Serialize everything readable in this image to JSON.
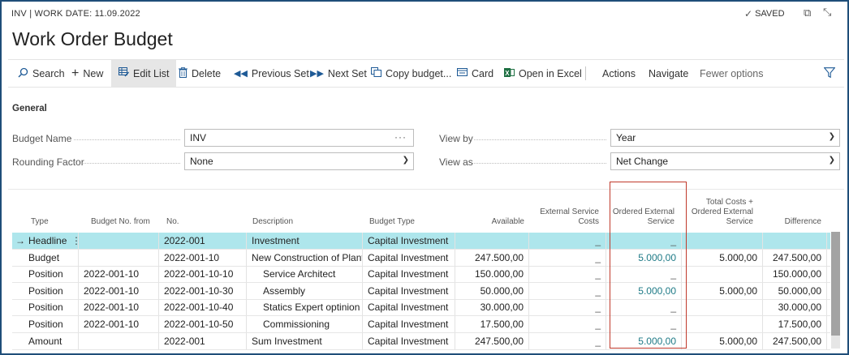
{
  "header": {
    "topline": "INV | WORK DATE: 11.09.2022",
    "saved": "SAVED",
    "title": "Work Order Budget"
  },
  "icons": {
    "saved": "check-icon",
    "open_new": "open-in-new-window-icon",
    "collapse": "collapse-icon",
    "filter": "filter-icon"
  },
  "actions": {
    "search": "Search",
    "new": "New",
    "edit_list": "Edit List",
    "delete": "Delete",
    "previous_set": "Previous Set",
    "next_set": "Next Set",
    "copy_budget": "Copy budget...",
    "card": "Card",
    "open_in_excel": "Open in Excel",
    "actions": "Actions",
    "navigate": "Navigate",
    "fewer_options": "Fewer options"
  },
  "general": {
    "title": "General",
    "budget_name_label": "Budget Name",
    "budget_name_value": "INV",
    "rounding_factor_label": "Rounding Factor",
    "rounding_factor_value": "None",
    "view_by_label": "View by",
    "view_by_value": "Year",
    "view_as_label": "View as",
    "view_as_value": "Net Change"
  },
  "table": {
    "headers": {
      "type": "Type",
      "budget_no_from": "Budget No. from",
      "no": "No.",
      "description": "Description",
      "budget_type": "Budget Type",
      "available": "Available",
      "external_service_costs_1": "External Service",
      "external_service_costs_2": "Costs",
      "ordered_external_service_1": "Ordered External",
      "ordered_external_service_2": "Service",
      "total_costs_1": "Total Costs +",
      "total_costs_2": "Ordered External",
      "total_costs_3": "Service",
      "difference": "Difference"
    },
    "rows": [
      {
        "type": "Headline",
        "budget_no_from": "",
        "no": "2022-001",
        "description": "Investment",
        "budget_type": "Capital Investment",
        "available": "",
        "external_service_costs": "_",
        "ordered_external_service": "_",
        "total_costs": "",
        "difference": ""
      },
      {
        "type": "Budget",
        "budget_no_from": "",
        "no": "2022-001-10",
        "description": "New Construction of Plant",
        "budget_type": "Capital Investment",
        "available": "247.500,00",
        "external_service_costs": "_",
        "ordered_external_service": "5.000,00",
        "total_costs": "5.000,00",
        "difference": "247.500,00"
      },
      {
        "type": "Position",
        "budget_no_from": "2022-001-10",
        "no": "2022-001-10-10",
        "description": "Service Architect",
        "budget_type": "Capital Investment",
        "available": "150.000,00",
        "external_service_costs": "_",
        "ordered_external_service": "_",
        "total_costs": "",
        "difference": "150.000,00"
      },
      {
        "type": "Position",
        "budget_no_from": "2022-001-10",
        "no": "2022-001-10-30",
        "description": "Assembly",
        "budget_type": "Capital Investment",
        "available": "50.000,00",
        "external_service_costs": "_",
        "ordered_external_service": "5.000,00",
        "total_costs": "5.000,00",
        "difference": "50.000,00"
      },
      {
        "type": "Position",
        "budget_no_from": "2022-001-10",
        "no": "2022-001-10-40",
        "description": "Statics Expert optinion",
        "budget_type": "Capital Investment",
        "available": "30.000,00",
        "external_service_costs": "_",
        "ordered_external_service": "_",
        "total_costs": "",
        "difference": "30.000,00"
      },
      {
        "type": "Position",
        "budget_no_from": "2022-001-10",
        "no": "2022-001-10-50",
        "description": "Commissioning",
        "budget_type": "Capital Investment",
        "available": "17.500,00",
        "external_service_costs": "_",
        "ordered_external_service": "_",
        "total_costs": "",
        "difference": "17.500,00"
      },
      {
        "type": "Amount",
        "budget_no_from": "",
        "no": "2022-001",
        "description": "Sum Investment",
        "budget_type": "Capital Investment",
        "available": "247.500,00",
        "external_service_costs": "_",
        "ordered_external_service": "5.000,00",
        "total_costs": "5.000,00",
        "difference": "247.500,00"
      }
    ]
  },
  "colors": {
    "selected_row": "#aee6ec",
    "link": "#1e7a86",
    "accent_icon": "#1e5a96",
    "highlight_box": "#c0392b",
    "frame": "#1f4e79"
  }
}
